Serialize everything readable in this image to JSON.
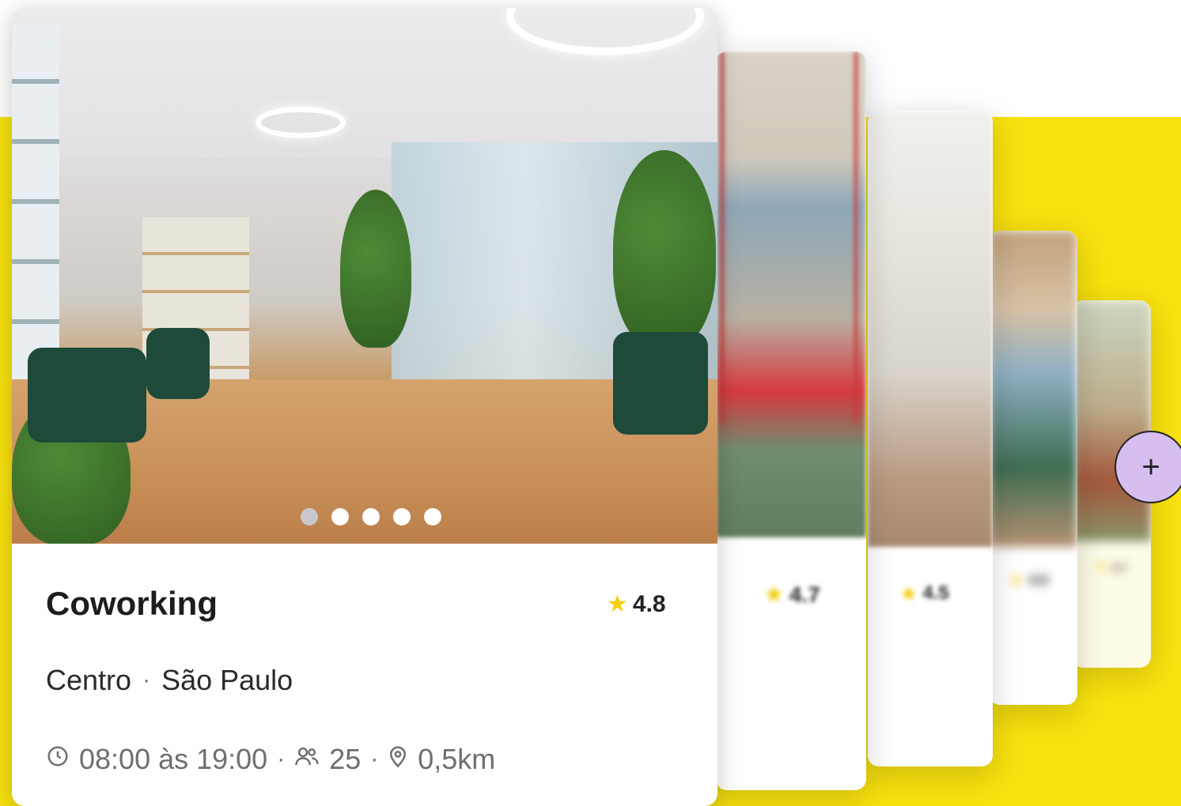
{
  "cards": {
    "front": {
      "title": "Coworking",
      "rating": "4.8",
      "neighborhood": "Centro",
      "city": "São Paulo",
      "location_separator": "·",
      "hours": "08:00 às 19:00",
      "capacity": "25",
      "distance": "0,5km",
      "meta_separator": "·",
      "carousel": {
        "total": 5,
        "active": 1
      }
    },
    "stacked": [
      {
        "rating": "4.7"
      },
      {
        "rating": "4.5"
      },
      {
        "rating": "4.6"
      },
      {
        "rating": "4.7"
      }
    ]
  },
  "icons": {
    "star": "star-icon",
    "clock": "clock-icon",
    "people": "people-icon",
    "pin": "location-pin-icon",
    "add": "plus-icon"
  },
  "colors": {
    "background_accent": "#f7e10e",
    "star": "#f2cf10",
    "add_button": "#d6bff0"
  },
  "add_button": {
    "label": "+"
  }
}
